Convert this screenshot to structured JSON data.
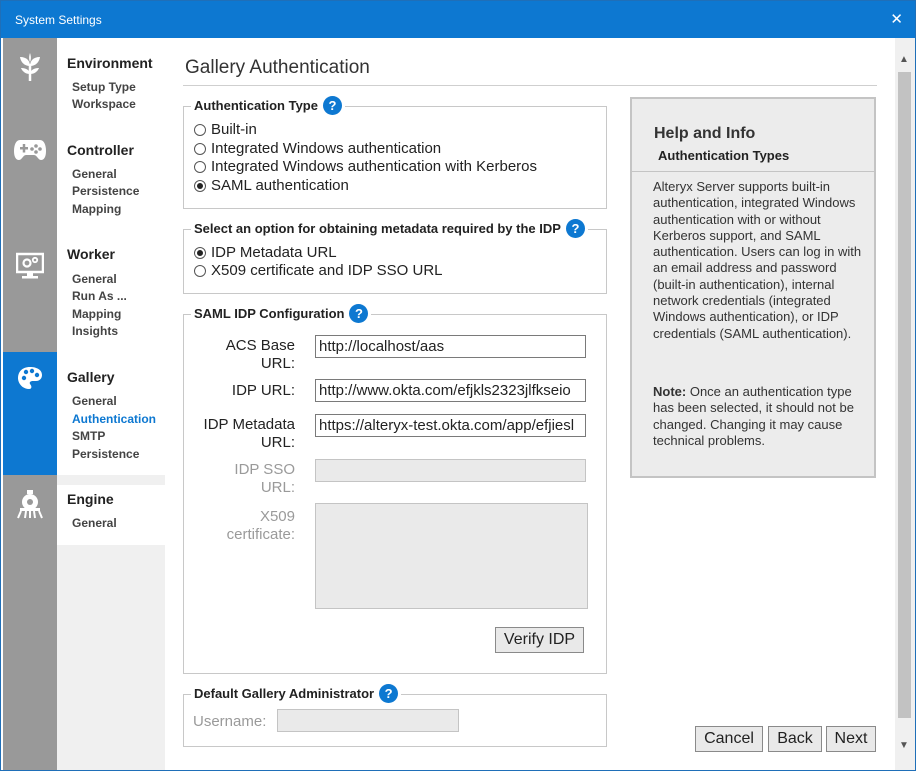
{
  "window": {
    "title": "System Settings",
    "close": "✕"
  },
  "nav": {
    "groups": [
      {
        "heading": "Environment",
        "items": [
          "Setup Type",
          "Workspace"
        ]
      },
      {
        "heading": "Controller",
        "items": [
          "General",
          "Persistence",
          "Mapping"
        ]
      },
      {
        "heading": "Worker",
        "items": [
          "General",
          "Run As ...",
          "Mapping",
          "Insights"
        ]
      },
      {
        "heading": "Gallery",
        "items": [
          "General",
          "Authentication",
          "SMTP",
          "Persistence"
        ],
        "active": true,
        "selected": "Authentication"
      },
      {
        "heading": "Engine",
        "items": [
          "General"
        ]
      }
    ],
    "icons": [
      "leaf-icon",
      "gamepad-icon",
      "monitor-gear-icon",
      "palette-icon",
      "engine-icon"
    ]
  },
  "page": {
    "title": "Gallery Authentication"
  },
  "auth_type": {
    "legend": "Authentication Type",
    "options": [
      "Built-in",
      "Integrated Windows authentication",
      "Integrated Windows authentication with Kerberos",
      "SAML authentication"
    ],
    "selected": "SAML authentication"
  },
  "metadata": {
    "legend": "Select an option for obtaining metadata required by the IDP",
    "options": [
      "IDP Metadata URL",
      "X509 certificate and IDP SSO URL"
    ],
    "selected": "IDP Metadata URL"
  },
  "saml": {
    "legend": "SAML IDP Configuration",
    "acs_label_1": "ACS Base",
    "acs_label_2": "URL:",
    "acs_value": "http://localhost/aas",
    "idp_url_label": "IDP URL:",
    "idp_url_value": "http://www.okta.com/efjkls2323jlfkseio",
    "idp_meta_label_1": "IDP Metadata",
    "idp_meta_label_2": "URL:",
    "idp_meta_value": "https://alteryx-test.okta.com/app/efjiesl",
    "idp_sso_label_1": "IDP SSO",
    "idp_sso_label_2": "URL:",
    "idp_sso_value": "",
    "x509_label_1": "X509",
    "x509_label_2": "certificate:",
    "x509_value": "",
    "verify_label": "Verify IDP"
  },
  "admin": {
    "legend": "Default Gallery Administrator",
    "username_label": "Username:",
    "username_value": ""
  },
  "help": {
    "title": "Help and Info",
    "subtitle": "Authentication Types",
    "body": "Alteryx Server supports built-in authentication, integrated Windows authentication with or without Kerberos support, and SAML authentication. Users can log in with an email address and password (built-in authentication), internal network credentials (integrated Windows authentication), or IDP credentials (SAML authentication).",
    "note_label": "Note:",
    "note_text": " Once an authentication type has been selected, it should not be changed. Changing it may cause technical problems."
  },
  "footer": {
    "cancel": "Cancel",
    "back": "Back",
    "next": "Next"
  },
  "help_mark": "?",
  "scroll": {
    "up": "▲",
    "down": "▼"
  },
  "colors": {
    "accent": "#0d78d1",
    "rail": "#999999",
    "panel": "#ececec"
  }
}
